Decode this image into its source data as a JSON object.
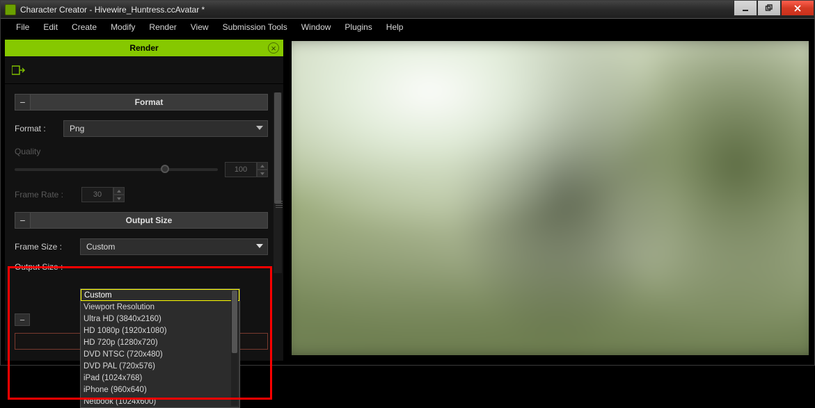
{
  "window": {
    "title": "Character Creator - Hivewire_Huntress.ccAvatar *"
  },
  "menu": {
    "items": [
      "File",
      "Edit",
      "Create",
      "Modify",
      "Render",
      "View",
      "Submission Tools",
      "Window",
      "Plugins",
      "Help"
    ]
  },
  "panel": {
    "title": "Render"
  },
  "sections": {
    "format_header": "Format",
    "output_size_header": "Output Size"
  },
  "fields": {
    "format_label": "Format :",
    "format_value": "Png",
    "quality_label": "Quality",
    "quality_value": "100",
    "frame_rate_label": "Frame Rate :",
    "frame_rate_value": "30",
    "frame_size_label": "Frame Size :",
    "frame_size_value": "Custom",
    "output_size_label": "Output Size :"
  },
  "frame_size_options": [
    "Custom",
    "Viewport Resolution",
    "Ultra HD (3840x2160)",
    "HD 1080p (1920x1080)",
    "HD 720p (1280x720)",
    "DVD NTSC (720x480)",
    "DVD PAL (720x576)",
    "iPad (1024x768)",
    "iPhone (960x640)",
    "Netbook (1024x600)"
  ]
}
